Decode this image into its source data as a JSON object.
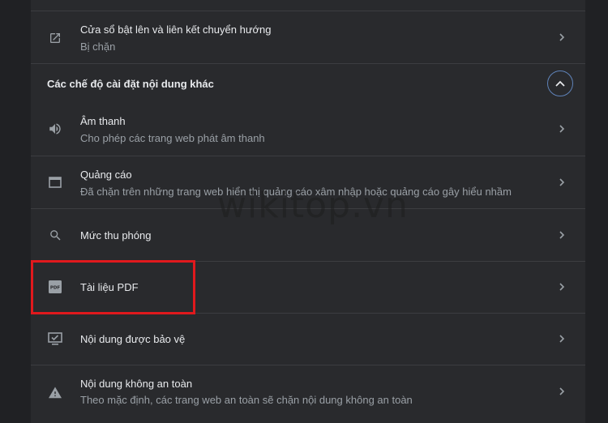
{
  "colors": {
    "background": "#202124",
    "panel": "#292a2d",
    "divider": "#3c3d41",
    "text_primary": "#e8eaed",
    "text_secondary": "#9aa0a6",
    "icon": "#9aa0a6",
    "accent_ring": "#5f83b9",
    "highlight_box": "#e0191d"
  },
  "rows_top": [
    {
      "title": "Cửa sổ bật lên và liên kết chuyển hướng",
      "subtitle": "Bị chặn",
      "icon": "open-in-new-icon"
    }
  ],
  "section": {
    "header": "Các chế độ cài đặt nội dung khác",
    "toggle_icon": "chevron-up-icon"
  },
  "rows": [
    {
      "title": "Âm thanh",
      "subtitle": "Cho phép các trang web phát âm thanh",
      "icon": "volume-icon"
    },
    {
      "title": "Quảng cáo",
      "subtitle": "Đã chặn trên những trang web hiển thị quảng cáo xâm nhập hoặc quảng cáo gây hiểu nhầm",
      "icon": "window-icon"
    },
    {
      "title": "Mức thu phóng",
      "icon": "search-icon"
    },
    {
      "title": "Tài liệu PDF",
      "icon": "pdf-icon",
      "pdf_icon_text": "PDF"
    },
    {
      "title": "Nội dung được bảo vệ",
      "icon": "protected-content-icon"
    },
    {
      "title": "Nội dung không an toàn",
      "subtitle": "Theo mặc định, các trang web an toàn sẽ chặn nội dung không an toàn",
      "icon": "warning-icon"
    }
  ],
  "watermark": "wikitop.vn"
}
